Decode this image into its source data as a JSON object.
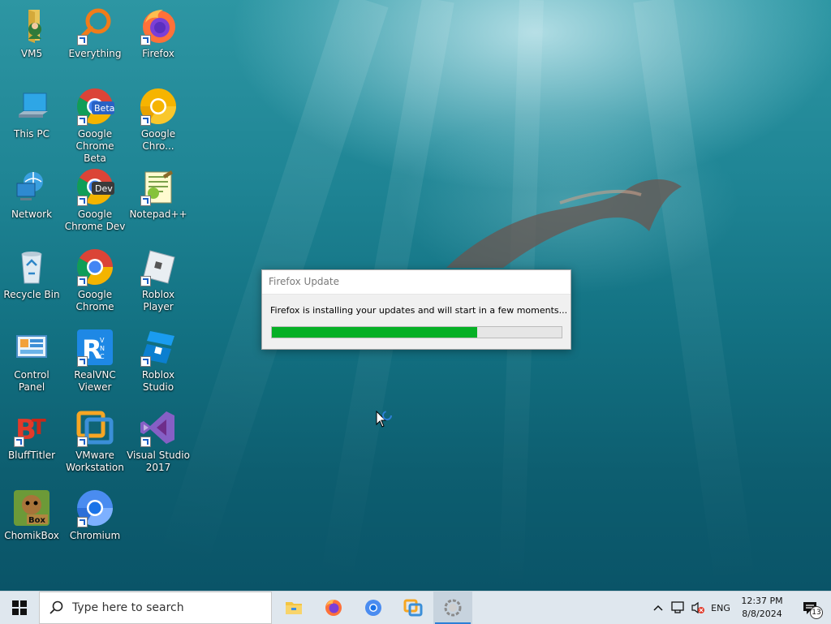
{
  "desktop": {
    "icons": [
      {
        "label": "VM5",
        "icon": "folder-user-icon"
      },
      {
        "label": "Everything",
        "icon": "magnifier-icon"
      },
      {
        "label": "Firefox",
        "icon": "firefox-icon"
      },
      {
        "label": "This PC",
        "icon": "computer-icon"
      },
      {
        "label": "Google Chrome Beta",
        "icon": "chrome-beta-icon",
        "badge": "Beta"
      },
      {
        "label": "Google Chro...",
        "icon": "chrome-canary-icon"
      },
      {
        "label": "Network",
        "icon": "network-icon"
      },
      {
        "label": "Google Chrome Dev",
        "icon": "chrome-dev-icon",
        "badge": "Dev"
      },
      {
        "label": "Notepad++",
        "icon": "notepadpp-icon"
      },
      {
        "label": "Recycle Bin",
        "icon": "recycle-bin-icon"
      },
      {
        "label": "Google Chrome",
        "icon": "chrome-icon"
      },
      {
        "label": "Roblox Player",
        "icon": "roblox-player-icon"
      },
      {
        "label": "Control Panel",
        "icon": "control-panel-icon"
      },
      {
        "label": "RealVNC Viewer",
        "icon": "realvnc-icon"
      },
      {
        "label": "Roblox Studio",
        "icon": "roblox-studio-icon"
      },
      {
        "label": "BluffTitler",
        "icon": "blufftitler-icon"
      },
      {
        "label": "VMware Workstation",
        "icon": "vmware-icon"
      },
      {
        "label": "Visual Studio 2017",
        "icon": "visual-studio-icon"
      },
      {
        "label": "ChomikBox",
        "icon": "chomikbox-icon",
        "badge": "Box"
      },
      {
        "label": "Chromium",
        "icon": "chromium-icon"
      }
    ]
  },
  "dialog": {
    "title": "Firefox Update",
    "message": "Firefox is installing your updates and will start in a few moments...",
    "progress": 0.71,
    "progress_color": "#06b025"
  },
  "taskbar": {
    "search_placeholder": "Type here to search",
    "apps": [
      {
        "name": "file-explorer",
        "icon": "folder-icon",
        "active": false
      },
      {
        "name": "firefox",
        "icon": "firefox-icon",
        "active": false
      },
      {
        "name": "chromium",
        "icon": "chromium-icon",
        "active": false
      },
      {
        "name": "vmware",
        "icon": "vmware-icon",
        "active": false
      },
      {
        "name": "firefox-updater",
        "icon": "updater-icon",
        "active": true
      }
    ],
    "tray": {
      "language": "ENG",
      "time": "12:37 PM",
      "date": "8/8/2024",
      "notification_count": "13"
    }
  },
  "colors": {
    "accent": "#2c7fd6",
    "taskbar_bg": "#dfe7ee"
  }
}
